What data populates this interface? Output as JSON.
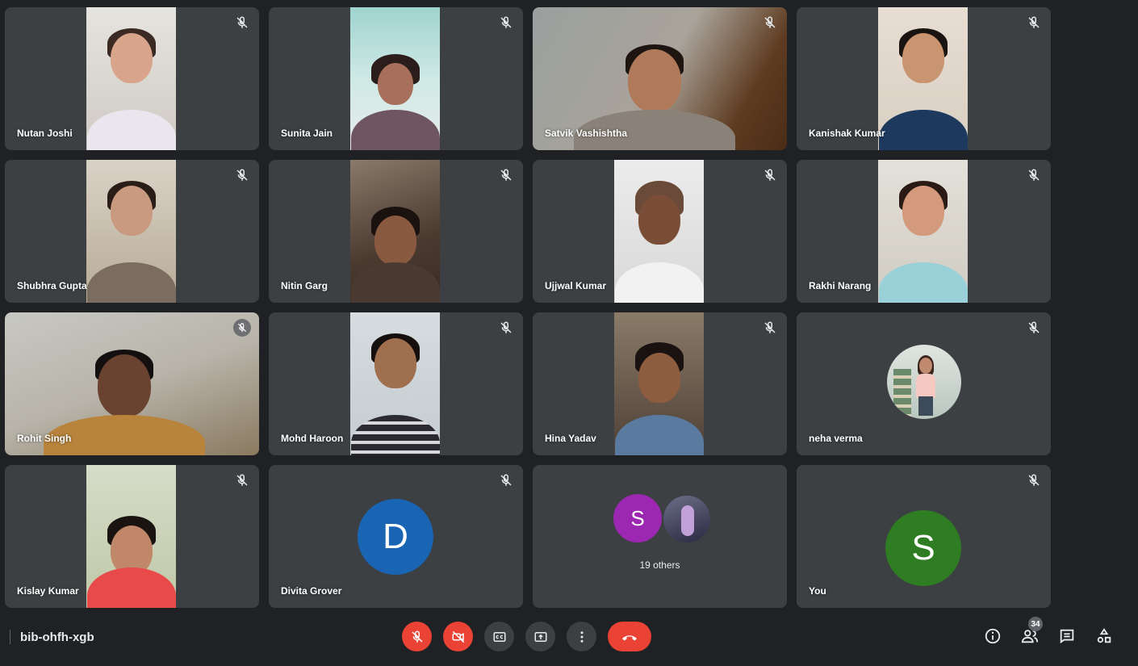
{
  "participants": [
    {
      "name": "Nutan Joshi",
      "muted": true
    },
    {
      "name": "Sunita Jain",
      "muted": true
    },
    {
      "name": "Satvik Vashishtha",
      "muted": true
    },
    {
      "name": "Kanishak Kumar",
      "muted": true
    },
    {
      "name": "Shubhra Gupta",
      "muted": true
    },
    {
      "name": "Nitin Garg",
      "muted": true
    },
    {
      "name": "Ujjwal Kumar",
      "muted": true
    },
    {
      "name": "Rakhi Narang",
      "muted": true
    },
    {
      "name": "Rohit Singh",
      "muted": true
    },
    {
      "name": "Mohd Haroon",
      "muted": true
    },
    {
      "name": "Hina Yadav",
      "muted": true
    },
    {
      "name": "neha verma",
      "muted": true
    },
    {
      "name": "Kislay Kumar",
      "muted": true
    },
    {
      "name": "Divita Grover",
      "muted": true,
      "avatar_letter": "D",
      "avatar_color": "#1a64b4"
    },
    {
      "others_label": "19 others",
      "avatar_letter": "S",
      "avatar_color": "#9c27b0"
    },
    {
      "name": "You",
      "muted": true,
      "avatar_letter": "S",
      "avatar_color": "#2e7d22"
    }
  ],
  "meeting": {
    "code": "bib-ohfh-xgb",
    "participant_count": "34"
  },
  "controls": {
    "mic": {
      "icon": "mic-off-icon",
      "state": "off",
      "color": "#ea4335"
    },
    "camera": {
      "icon": "videocam-off-icon",
      "state": "off",
      "color": "#ea4335"
    },
    "captions": {
      "icon": "closed-caption-icon"
    },
    "present": {
      "icon": "present-screen-icon"
    },
    "more": {
      "icon": "more-vert-icon"
    },
    "hangup": {
      "icon": "call-end-icon",
      "color": "#ea4335"
    }
  },
  "right_controls": [
    "info-icon",
    "people-icon",
    "chat-icon",
    "activities-icon"
  ]
}
